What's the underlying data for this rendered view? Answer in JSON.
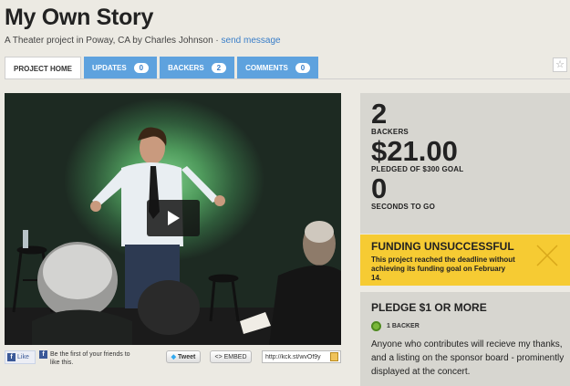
{
  "project": {
    "title": "My Own Story",
    "subtitle_prefix": "A Theater project in Poway, CA by Charles Johnson · ",
    "send_message": "send message"
  },
  "tabs": [
    {
      "label": "PROJECT HOME",
      "count": null,
      "active": true
    },
    {
      "label": "UPDATES",
      "count": "0"
    },
    {
      "label": "BACKERS",
      "count": "2"
    },
    {
      "label": "COMMENTS",
      "count": "0"
    }
  ],
  "share": {
    "like_label": "Like",
    "like_text": "Be the first of your friends to like this.",
    "tweet_label": "Tweet",
    "embed_label": "<> EMBED",
    "short_url": "http://kck.st/wvOf9y"
  },
  "stats": {
    "backers_value": "2",
    "backers_label": "BACKERS",
    "pledged_value": "$21.00",
    "pledged_label": "PLEDGED OF $300 GOAL",
    "seconds_value": "0",
    "seconds_label": "SECONDS TO GO"
  },
  "funding": {
    "title": "FUNDING UNSUCCESSFUL",
    "text": "This project reached the deadline without achieving its funding goal on February 14."
  },
  "reward": {
    "title": "PLEDGE $1 OR MORE",
    "backers": "1 BACKER",
    "description": "Anyone who contributes will recieve my thanks, and a listing on the sponsor board - prominently displayed at the concert."
  },
  "colors": {
    "tab_blue": "#5ea2de",
    "link_blue": "#3a7ec8",
    "funding_yellow": "#f6cb33",
    "panel_gray": "#d7d6d0"
  },
  "icons": [
    "star-icon",
    "play-icon",
    "facebook-icon",
    "twitter-bird-icon",
    "copy-icon",
    "close-x-icon",
    "reward-leaf-icon"
  ]
}
